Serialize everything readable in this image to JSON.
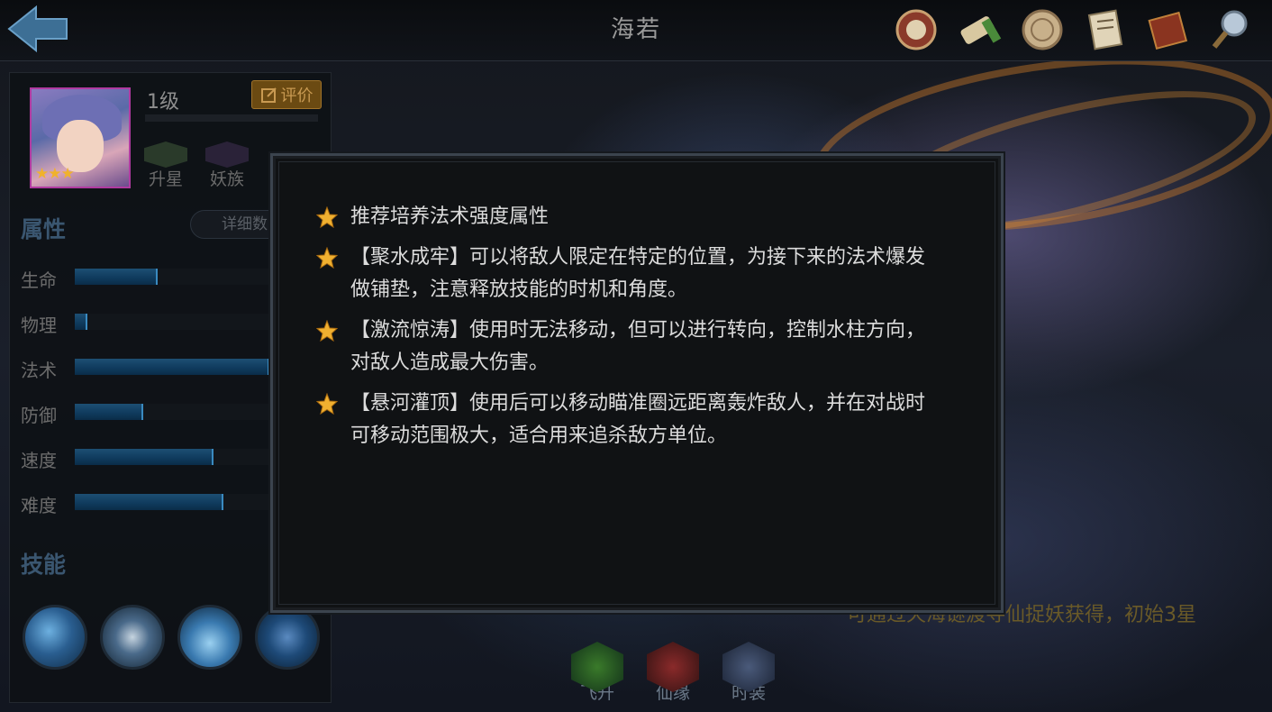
{
  "header": {
    "title": "海若",
    "icons": [
      "badge-icon",
      "scroll-icon",
      "coin-icon",
      "document-icon",
      "book-icon",
      "magnifier-icon"
    ]
  },
  "hero": {
    "level": "1级",
    "rate_label": "评价",
    "star_count": 3,
    "badges": [
      {
        "label": "升星"
      },
      {
        "label": "妖族"
      }
    ]
  },
  "attributes": {
    "title": "属性",
    "detail_label": "详细数",
    "stats": [
      {
        "name": "生命",
        "value": 0.34
      },
      {
        "name": "物理",
        "value": 0.05
      },
      {
        "name": "法术",
        "value": 0.8
      },
      {
        "name": "防御",
        "value": 0.28
      },
      {
        "name": "速度",
        "value": 0.57
      },
      {
        "name": "难度",
        "value": 0.61
      }
    ]
  },
  "skills": {
    "title": "技能"
  },
  "bottom_tabs": [
    {
      "label": "飞升"
    },
    {
      "label": "仙缘"
    },
    {
      "label": "时装"
    }
  ],
  "source_text": "可通过天海谜渡寻仙捉妖获得，初始3星",
  "tips_dialog": {
    "tips": [
      "推荐培养法术强度属性",
      "【聚水成牢】可以将敌人限定在特定的位置，为接下来的法术爆发做铺垫，注意释放技能的时机和角度。",
      "【激流惊涛】使用时无法移动，但可以进行转向，控制水柱方向，对敌人造成最大伤害。",
      "【悬河灌顶】使用后可以移动瞄准圈远距离轰炸敌人，并在对战时可移动范围极大，适合用来追杀敌方单位。"
    ]
  }
}
